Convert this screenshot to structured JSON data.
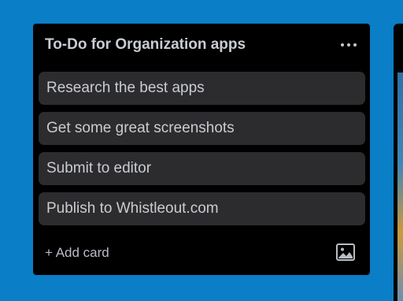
{
  "list": {
    "title": "To-Do for Organization apps",
    "menu_icon": "more-horizontal-icon",
    "cards": [
      {
        "text": "Research the best apps"
      },
      {
        "text": "Get some great screenshots"
      },
      {
        "text": "Submit to editor"
      },
      {
        "text": "Publish to Whistleout.com"
      }
    ],
    "add_card_label": "+ Add card",
    "template_icon": "image-icon"
  },
  "colors": {
    "board_background": "#0a7ec6",
    "list_background": "#000000",
    "card_background": "#2c2c2e",
    "text": "#c9ccd2"
  }
}
